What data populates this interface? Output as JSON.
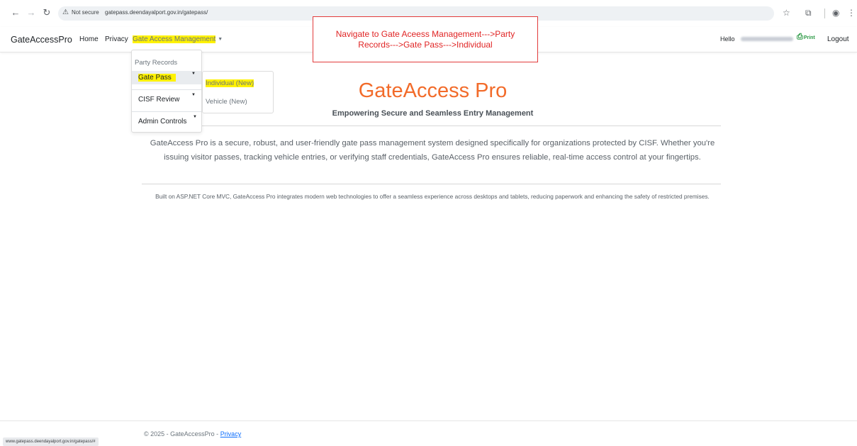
{
  "browser": {
    "security_label": "Not secure",
    "url": "gatepass.deendayalport.gov.in/gatepass/",
    "status_url": "www.gatepass.deendayalport.gov.in/gatepass/#"
  },
  "navbar": {
    "brand": "GateAccessPro",
    "links": [
      "Home",
      "Privacy"
    ],
    "gate_access_management": "Gate Access Management",
    "hello": "Hello",
    "print": "Print",
    "logout": "Logout"
  },
  "annotation": {
    "text": "Navigate to Gate Aceess Management--->Party Records--->Gate Pass--->Individual"
  },
  "dropdown": {
    "header": "Party Records",
    "items": [
      "Gate Pass",
      "CISF Review",
      "Admin Controls"
    ]
  },
  "submenu": {
    "items": [
      "Individual (New)",
      "Vehicle (New)"
    ]
  },
  "main": {
    "title": "GateAccess Pro",
    "subtitle": "Empowering Secure and Seamless Entry Management",
    "intro": "GateAccess Pro is a secure, robust, and user-friendly gate pass management system designed specifically for organizations protected by CISF. Whether you're issuing visitor passes, tracking vehicle entries, or verifying staff credentials, GateAccess Pro ensures reliable, real-time access control at your fingertips.",
    "built_on": "Built on ASP.NET Core MVC, GateAccess Pro integrates modern web technologies to offer a seamless experience across desktops and tablets, reducing paperwork and enhancing the safety of restricted premises."
  },
  "footer": {
    "copyright": "© 2025 - GateAccessPro - ",
    "privacy": "Privacy"
  },
  "colors": {
    "highlight": "#fff200",
    "title_orange": "#f26b2a",
    "annotation_red": "#e02424",
    "link_blue": "#0d6efd"
  }
}
